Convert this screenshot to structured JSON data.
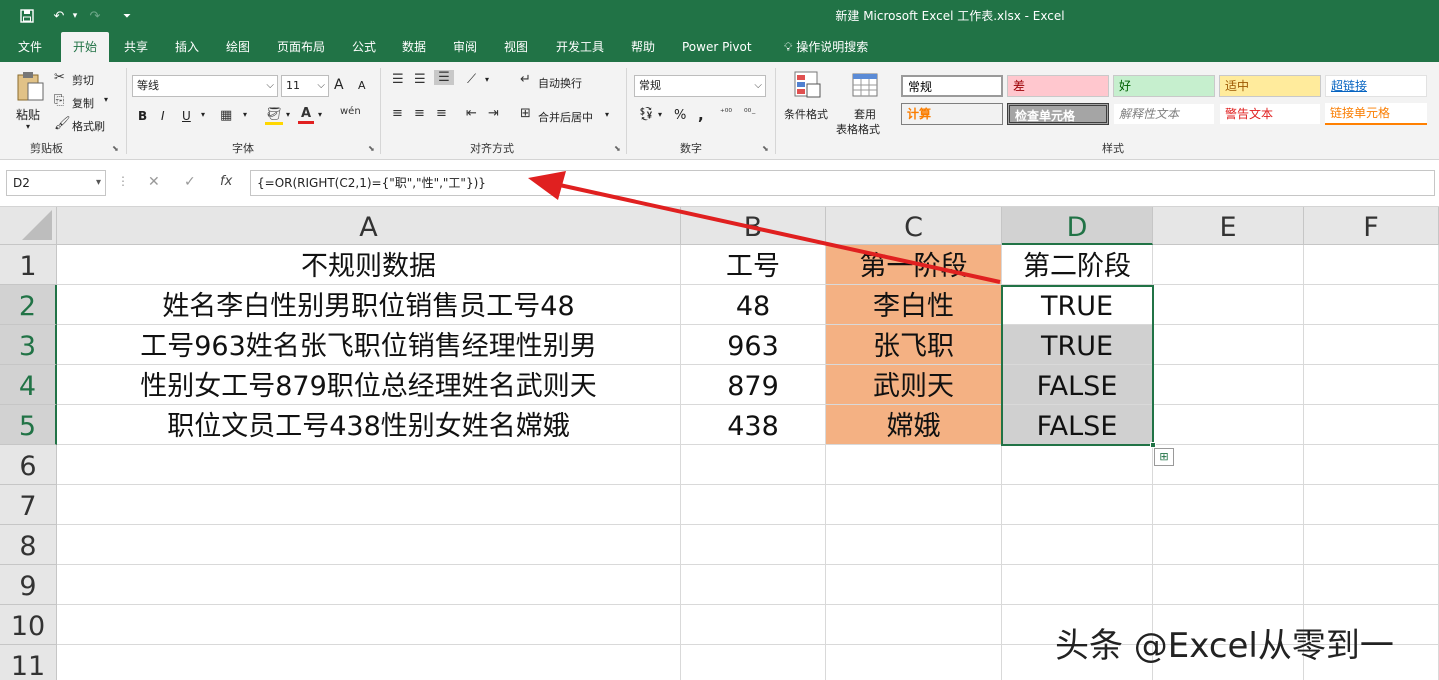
{
  "window": {
    "title": "新建 Microsoft Excel 工作表.xlsx  -  Excel"
  },
  "tabs": [
    "文件",
    "开始",
    "共享",
    "插入",
    "绘图",
    "页面布局",
    "公式",
    "数据",
    "审阅",
    "视图",
    "开发工具",
    "帮助",
    "Power Pivot",
    "操作说明搜索"
  ],
  "active_tab": "开始",
  "ribbon": {
    "clipboard": {
      "paste": "粘贴",
      "cut": "剪切",
      "copy": "复制",
      "format_painter": "格式刷",
      "label": "剪贴板"
    },
    "font": {
      "name": "等线",
      "size": "11",
      "bold": "B",
      "italic": "I",
      "underline": "U",
      "grow": "A",
      "shrink": "A",
      "label": "字体"
    },
    "alignment": {
      "wrap": "自动换行",
      "merge": "合并后居中",
      "label": "对齐方式"
    },
    "number": {
      "format": "常规",
      "percent": "%",
      "comma": ",",
      "label": "数字"
    },
    "styles": {
      "conditional": "条件格式",
      "table_1": "套用",
      "table_2": "表格格式",
      "label": "样式",
      "cells": [
        "常规",
        "差",
        "好",
        "适中",
        "超链接",
        "计算",
        "检查单元格",
        "解释性文本",
        "警告文本",
        "链接单元格"
      ]
    }
  },
  "formula_bar": {
    "name_box": "D2",
    "cancel": "✕",
    "enter": "✓",
    "fx": "fx",
    "formula": "{=OR(RIGHT(C2,1)={\"职\",\"性\",\"工\"})}"
  },
  "columns": [
    "A",
    "B",
    "C",
    "D",
    "E",
    "F"
  ],
  "rows": [
    "1",
    "2",
    "3",
    "4",
    "5",
    "6",
    "7",
    "8",
    "9",
    "10",
    "11"
  ],
  "sheet": {
    "header": {
      "a": "不规则数据",
      "b": "工号",
      "c": "第一阶段",
      "d": "第二阶段"
    },
    "data": [
      {
        "a": "姓名李白性别男职位销售员工号48",
        "b": "48",
        "c": "李白性",
        "d": "TRUE"
      },
      {
        "a": "工号963姓名张飞职位销售经理性别男",
        "b": "963",
        "c": "张飞职",
        "d": "TRUE"
      },
      {
        "a": "性别女工号879职位总经理姓名武则天",
        "b": "879",
        "c": "武则天",
        "d": "FALSE"
      },
      {
        "a": "职位文员工号438性别女姓名嫦娥",
        "b": "438",
        "c": "嫦娥",
        "d": "FALSE"
      }
    ]
  },
  "selected_cell": "D2",
  "watermark": "头条 @Excel从零到一",
  "colors": {
    "excel_green": "#217346",
    "highlight_orange": "#f4b183",
    "selected_gray": "#d0d0d0",
    "arrow_red": "#e02020"
  }
}
